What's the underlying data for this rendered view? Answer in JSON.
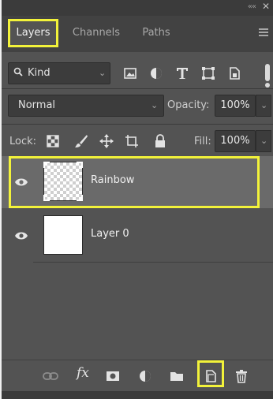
{
  "panel": {
    "tabs": [
      {
        "label": "Layers",
        "active": true
      },
      {
        "label": "Channels",
        "active": false
      },
      {
        "label": "Paths",
        "active": false
      }
    ],
    "collapse_glyph": "««",
    "close_glyph": "✕"
  },
  "filter": {
    "kind_label": "Kind",
    "icons": [
      "image-filter-icon",
      "adjustment-filter-icon",
      "type-filter-icon",
      "shape-filter-icon",
      "smart-object-filter-icon"
    ]
  },
  "blend": {
    "mode": "Normal",
    "opacity_label": "Opacity:",
    "opacity_value": "100%"
  },
  "lock": {
    "label": "Lock:",
    "fill_label": "Fill:",
    "fill_value": "100%"
  },
  "layers": [
    {
      "name": "Rainbow",
      "visible": true,
      "selected": true,
      "thumbnail": "transparent"
    },
    {
      "name": "Layer 0",
      "visible": true,
      "selected": false,
      "thumbnail": "white"
    }
  ],
  "colors": {
    "panel_bg": "#535353",
    "selected_row": "#6a6a6a",
    "highlight": "#f2f23a"
  }
}
